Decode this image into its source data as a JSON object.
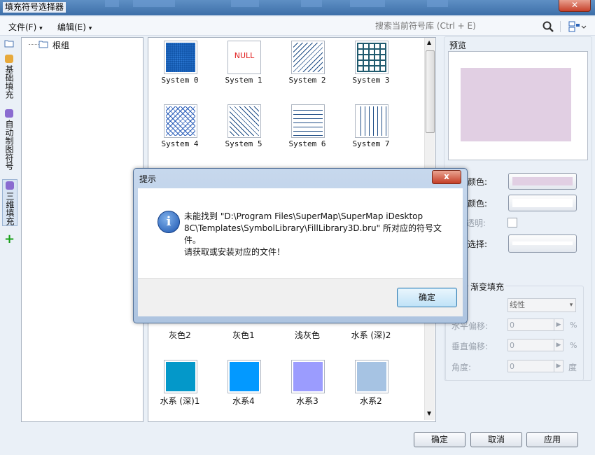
{
  "window": {
    "title": "填充符号选择器",
    "close": "✕"
  },
  "menu": {
    "file": "文件(F)",
    "edit": "编辑(E)"
  },
  "search": {
    "placeholder": "搜索当前符号库 (Ctrl + E)"
  },
  "side_tabs": [
    {
      "label": "基础填充",
      "color": "#e7a93b"
    },
    {
      "label": "自动制图符号",
      "color": "#8a6bd0"
    },
    {
      "label": "三维填充",
      "color": "#8a6bd0"
    }
  ],
  "tree": {
    "root": "根组"
  },
  "symbols": [
    {
      "label": "System 0",
      "pattern": "dots"
    },
    {
      "label": "System 1",
      "pattern": "null",
      "text": "NULL"
    },
    {
      "label": "System 2",
      "pattern": "diag-right"
    },
    {
      "label": "System 3",
      "pattern": "grid"
    },
    {
      "label": "System 4",
      "pattern": "cross-hatch"
    },
    {
      "label": "System 5",
      "pattern": "diag-left"
    },
    {
      "label": "System 6",
      "pattern": "horizontal"
    },
    {
      "label": "System 7",
      "pattern": "vertical"
    }
  ],
  "hidden_row_colors": [
    "#7f97c6",
    "#7b4fc4",
    "#8a5d57",
    "#9a9a9a"
  ],
  "colors_row1": [
    {
      "label": "灰色2",
      "color": "#e9dfd6"
    },
    {
      "label": "灰色1",
      "color": "#e3e3da"
    },
    {
      "label": "浅灰色",
      "color": "#ebebeb"
    },
    {
      "label": "水系 (深)2",
      "color": "#1b4fd1"
    }
  ],
  "colors_row2": [
    {
      "label": "水系 (深)1",
      "color": "#0498c9"
    },
    {
      "label": "水系4",
      "color": "#0399ff"
    },
    {
      "label": "水系3",
      "color": "#9b9cfe"
    },
    {
      "label": "水系2",
      "color": "#a6c3e3"
    }
  ],
  "preview": {
    "label": "预览",
    "fill_color": "#e1cfe3"
  },
  "props": {
    "fore_color_label": "颜色:",
    "fore_color": "#e1cfe3",
    "back_color_label": "颜色:",
    "back_color": "#ffffff",
    "transparent_label": "透明:",
    "select_label": "选择:"
  },
  "gradient": {
    "title": "渐变填充",
    "type_value": "线性",
    "h_offset_label": "水平偏移:",
    "h_offset_value": "0",
    "v_offset_label": "垂直偏移:",
    "v_offset_value": "0",
    "angle_label": "角度:",
    "angle_value": "0",
    "percent": "%",
    "degree": "度"
  },
  "buttons": {
    "ok": "确定",
    "cancel": "取消",
    "apply": "应用"
  },
  "dialog": {
    "title": "提示",
    "close": "x",
    "message": "未能找到 \"D:\\Program Files\\SuperMap\\SuperMap iDesktop 8C\\Templates\\SymbolLibrary\\FillLibrary3D.bru\" 所对应的符号文件。",
    "message2": "请获取或安装对应的文件！",
    "ok": "确定"
  }
}
